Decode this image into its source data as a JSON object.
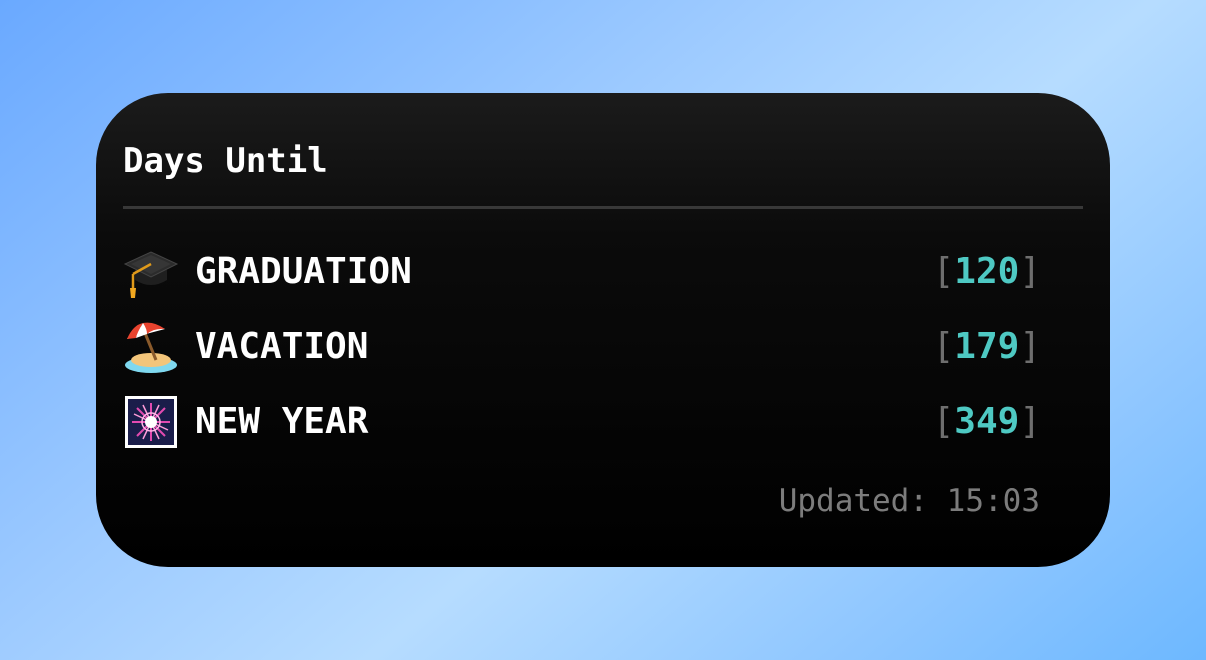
{
  "widget": {
    "title": "Days Until",
    "items": [
      {
        "icon": "graduation-cap-icon",
        "label": "GRADUATION",
        "days": "120"
      },
      {
        "icon": "beach-umbrella-icon",
        "label": "VACATION",
        "days": "179"
      },
      {
        "icon": "fireworks-icon",
        "label": "NEW YEAR",
        "days": "349"
      }
    ],
    "open_bracket": "[",
    "close_bracket": "]",
    "updated_text": "Updated: 15:03"
  },
  "colors": {
    "accent": "#4ec9c3",
    "text": "#ffffff",
    "muted": "#7c7c7c",
    "widget_bg": "#000000"
  }
}
